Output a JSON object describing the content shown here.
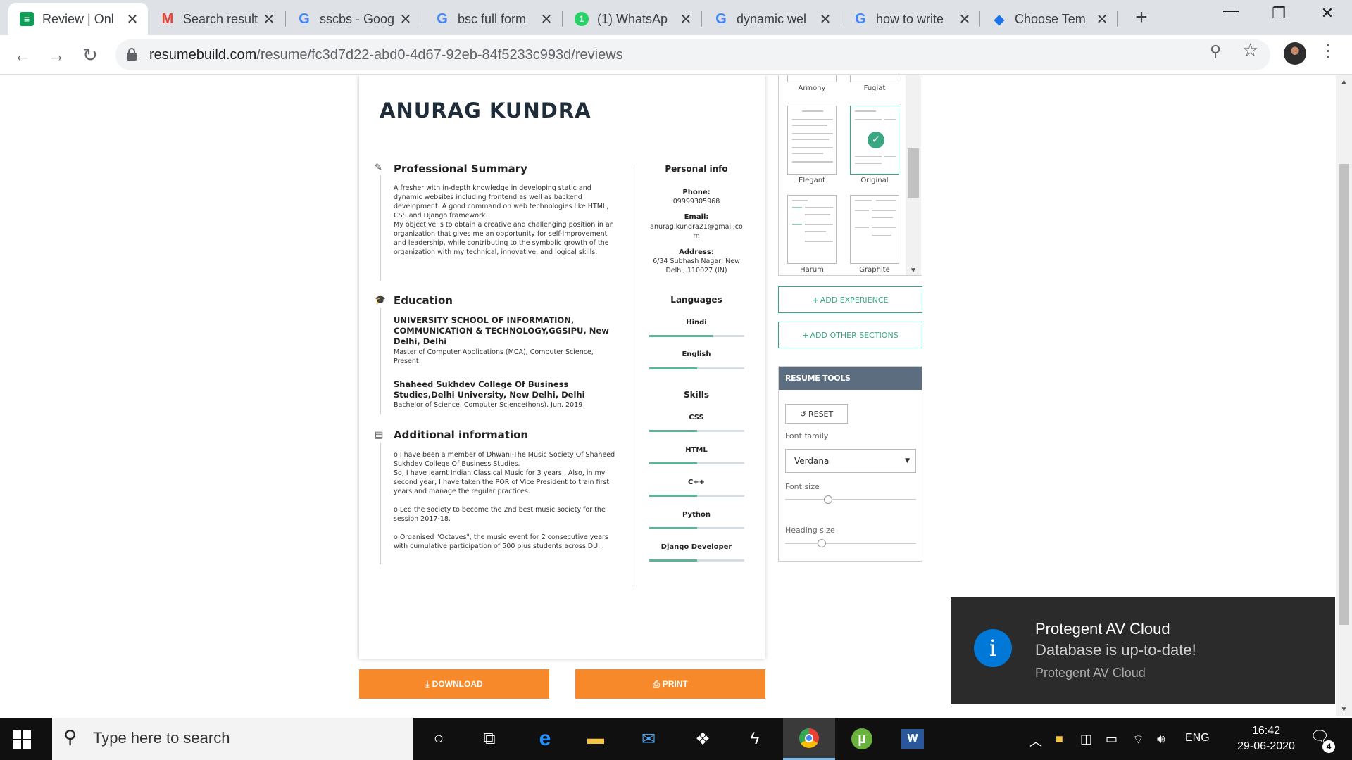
{
  "browser": {
    "tabs": [
      {
        "title": "Review | Onl",
        "icon": "doc-icon",
        "active": true
      },
      {
        "title": "Search result",
        "icon": "gmail-icon"
      },
      {
        "title": "sscbs - Goog",
        "icon": "google-icon"
      },
      {
        "title": "bsc full form",
        "icon": "google-icon"
      },
      {
        "title": "(1) WhatsAp",
        "icon": "whatsapp-icon"
      },
      {
        "title": "dynamic wel",
        "icon": "google-icon"
      },
      {
        "title": "how to write",
        "icon": "google-icon"
      },
      {
        "title": "Choose Tem",
        "icon": "resumebuild-icon"
      }
    ],
    "close_glyph": "✕",
    "url_host": "resumebuild.com",
    "url_path": "/resume/fc3d7d22-abd0-4d67-92eb-84f5233c993d/reviews"
  },
  "resume": {
    "name": "ANURAG KUNDRA",
    "summary": {
      "heading": "Professional Summary",
      "text": "A fresher with in-depth knowledge in developing static and dynamic websites including frontend as well as backend development. A good command on web technologies like HTML, CSS and Django framework.",
      "objective": "My objective is to obtain a creative and challenging position in an organization that gives me an opportunity for self-improvement and leadership, while contributing to the symbolic growth of the organization with my technical, innovative, and logical skills."
    },
    "education": {
      "heading": "Education",
      "items": [
        {
          "school": "UNIVERSITY SCHOOL OF INFORMATION, COMMUNICATION & TECHNOLOGY,GGSIPU, New Delhi, Delhi",
          "detail": "Master of Computer Applications (MCA), Computer Science, Present"
        },
        {
          "school": "Shaheed Sukhdev College Of Business Studies,Delhi University, New Delhi, Delhi",
          "detail": "Bachelor of Science, Computer Science(hons), Jun. 2019"
        }
      ]
    },
    "additional": {
      "heading": "Additional information",
      "items": [
        "o  I have been a member of Dhwani-The Music Society Of Shaheed Sukhdev College Of Business Studies.\n   So, I have learnt Indian Classical Music for 3 years . Also, in my second year, I have taken the POR of Vice President to train first years and manage the regular practices.",
        "o   Led the society to become the 2nd best music society for the session 2017-18.",
        "o   Organised \"Octaves\", the music event for 2 consecutive years with cumulative participation of 500 plus students across DU."
      ]
    },
    "personal": {
      "heading": "Personal info",
      "phone_label": "Phone:",
      "phone": "09999305968",
      "email_label": "Email:",
      "email": "anurag.kundra21@gmail.com",
      "address_label": "Address:",
      "address": "6/34 Subhash Nagar, New Delhi, 110027 (IN)"
    },
    "languages": {
      "heading": "Languages",
      "items": [
        {
          "name": "Hindi",
          "level": 0.67
        },
        {
          "name": "English",
          "level": 0.5
        }
      ]
    },
    "skills": {
      "heading": "Skills",
      "items": [
        {
          "name": "CSS",
          "level": 0.5
        },
        {
          "name": "HTML",
          "level": 0.5
        },
        {
          "name": "C++",
          "level": 0.5
        },
        {
          "name": "Python",
          "level": 0.5
        },
        {
          "name": "Django Developer",
          "level": 0.5
        }
      ]
    }
  },
  "actions": {
    "download": "DOWNLOAD",
    "print": "PRINT",
    "add_experience": "ADD EXPERIENCE",
    "add_other": "ADD OTHER SECTIONS"
  },
  "templates": {
    "names": [
      "Armony",
      "Fugiat",
      "Elegant",
      "Original",
      "Harum",
      "Graphite"
    ],
    "selected": "Original"
  },
  "tools": {
    "heading": "RESUME TOOLS",
    "reset": "RESET",
    "font_family_label": "Font family",
    "font_family_value": "Verdana",
    "font_size_label": "Font size",
    "font_size_level": 0.33,
    "heading_size_label": "Heading size",
    "heading_size_level": 0.28
  },
  "toast": {
    "title": "Protegent AV Cloud",
    "message": "Database is up-to-date!",
    "source": "Protegent AV Cloud"
  },
  "taskbar": {
    "search_placeholder": "Type here to search",
    "language": "ENG",
    "time": "16:42",
    "date": "29-06-2020",
    "notifications_count": "4"
  }
}
